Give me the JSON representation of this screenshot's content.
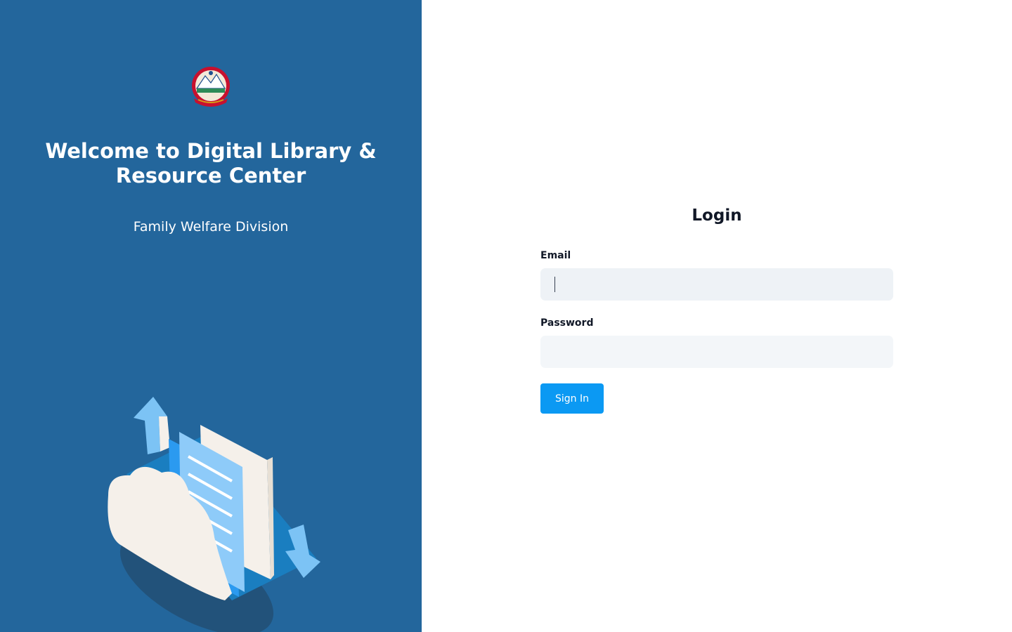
{
  "left_panel": {
    "welcome_title": "Welcome to Digital Library & Resource Center",
    "division_name": "Family Welfare Division",
    "emblem_icon": "nepal-emblem-icon",
    "illustration_icon": "cloud-documents-icon",
    "background_color": "#23669c"
  },
  "login": {
    "heading": "Login",
    "email_label": "Email",
    "email_value": "",
    "password_label": "Password",
    "password_value": "",
    "signin_label": "Sign In",
    "accent_color": "#0b99f3"
  }
}
